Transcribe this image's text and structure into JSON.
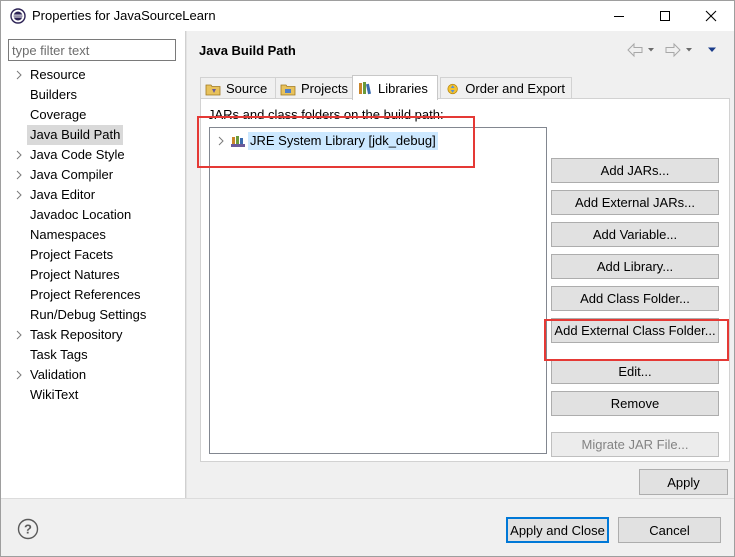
{
  "window": {
    "title": "Properties for JavaSourceLearn"
  },
  "filter": {
    "placeholder": "type filter text",
    "value": ""
  },
  "tree": {
    "items": [
      {
        "label": "Resource",
        "expandable": true,
        "selected": false
      },
      {
        "label": "Builders",
        "expandable": false,
        "selected": false
      },
      {
        "label": "Coverage",
        "expandable": false,
        "selected": false
      },
      {
        "label": "Java Build Path",
        "expandable": false,
        "selected": true
      },
      {
        "label": "Java Code Style",
        "expandable": true,
        "selected": false
      },
      {
        "label": "Java Compiler",
        "expandable": true,
        "selected": false
      },
      {
        "label": "Java Editor",
        "expandable": true,
        "selected": false
      },
      {
        "label": "Javadoc Location",
        "expandable": false,
        "selected": false
      },
      {
        "label": "Namespaces",
        "expandable": false,
        "selected": false
      },
      {
        "label": "Project Facets",
        "expandable": false,
        "selected": false
      },
      {
        "label": "Project Natures",
        "expandable": false,
        "selected": false
      },
      {
        "label": "Project References",
        "expandable": false,
        "selected": false
      },
      {
        "label": "Run/Debug Settings",
        "expandable": false,
        "selected": false
      },
      {
        "label": "Task Repository",
        "expandable": true,
        "selected": false
      },
      {
        "label": "Task Tags",
        "expandable": false,
        "selected": false
      },
      {
        "label": "Validation",
        "expandable": true,
        "selected": false
      },
      {
        "label": "WikiText",
        "expandable": false,
        "selected": false
      }
    ]
  },
  "page": {
    "title": "Java Build Path"
  },
  "tabs": [
    {
      "label": "Source",
      "icon": "source-folder-icon",
      "active": false
    },
    {
      "label": "Projects",
      "icon": "projects-icon",
      "active": false
    },
    {
      "label": "Libraries",
      "icon": "libraries-icon",
      "active": true
    },
    {
      "label": "Order and Export",
      "icon": "order-export-icon",
      "active": false
    }
  ],
  "libraries": {
    "description": "JARs and class folders on the build path:",
    "entries": [
      {
        "label": "JRE System Library [jdk_debug]",
        "icon": "library-icon"
      }
    ]
  },
  "buttons": {
    "add_jars": "Add JARs...",
    "add_external_jars": "Add External JARs...",
    "add_variable": "Add Variable...",
    "add_library": "Add Library...",
    "add_class_folder": "Add Class Folder...",
    "add_external_class_folder": "Add External Class Folder...",
    "edit": "Edit...",
    "remove": "Remove",
    "migrate_jar": "Migrate JAR File...",
    "apply": "Apply",
    "apply_and_close": "Apply and Close",
    "cancel": "Cancel"
  },
  "colors": {
    "highlight_box": "#e53935",
    "selection": "#cce8ff",
    "default_button_border": "#0078d7"
  }
}
